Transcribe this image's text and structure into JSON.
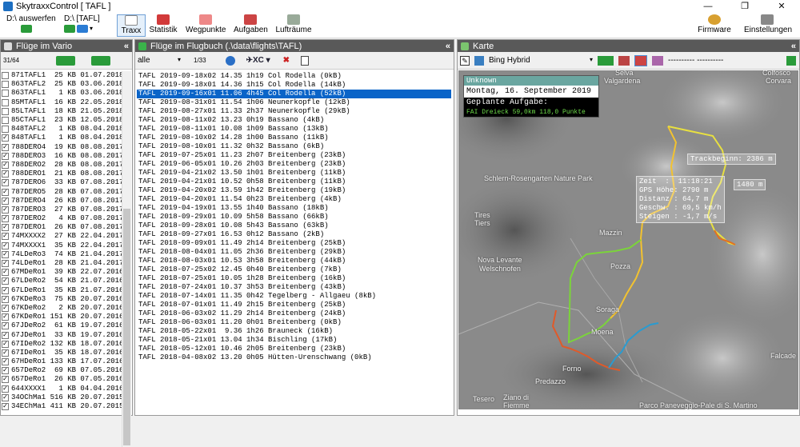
{
  "window": {
    "title": "SkytraxxControl [ TAFL ]",
    "min": "—",
    "max": "❐",
    "close": "✕"
  },
  "toolbar": {
    "drive1": "D:\\ auswerfen",
    "drive2": "D:\\ [TAFL]",
    "traxx": "Traxx",
    "statistik": "Statistik",
    "wegpunkte": "Wegpunkte",
    "aufgaben": "Aufgaben",
    "luftraeume": "Lufträume",
    "firmware": "Firmware",
    "einstellungen": "Einstellungen"
  },
  "vario": {
    "header": "Flüge im Vario",
    "count": "31/64",
    "rows": [
      {
        "c": false,
        "t": "871TAFL1  25 KB 01.07.2018"
      },
      {
        "c": false,
        "t": "863TAFL2  25 KB 03.06.2018"
      },
      {
        "c": false,
        "t": "863TAFL1   1 KB 03.06.2018"
      },
      {
        "c": false,
        "t": "85MTAFL1  16 KB 22.05.2018"
      },
      {
        "c": false,
        "t": "85LTAFL1  18 KB 21.05.2018"
      },
      {
        "c": false,
        "t": "85CTAFL1  23 KB 12.05.2018"
      },
      {
        "c": false,
        "t": "848TAFL2   1 KB 08.04.2018"
      },
      {
        "c": true,
        "t": "848TAFL1   1 KB 08.04.2018"
      },
      {
        "c": true,
        "t": "788DERO4  19 KB 08.08.2017"
      },
      {
        "c": true,
        "t": "788DERO3  16 KB 08.08.2017"
      },
      {
        "c": true,
        "t": "788DERO2  28 KB 08.08.2017"
      },
      {
        "c": true,
        "t": "788DERO1  21 KB 08.08.2017"
      },
      {
        "c": true,
        "t": "787DERO6  33 KB 07.08.2017"
      },
      {
        "c": true,
        "t": "787DERO5  28 KB 07.08.2017"
      },
      {
        "c": true,
        "t": "787DERO4  26 KB 07.08.2017"
      },
      {
        "c": true,
        "t": "787DERO3  27 KB 07.08.2017"
      },
      {
        "c": true,
        "t": "787DERO2   4 KB 07.08.2017"
      },
      {
        "c": true,
        "t": "787DERO1  26 KB 07.08.2017"
      },
      {
        "c": true,
        "t": "74MXXXX2  27 KB 22.04.2017"
      },
      {
        "c": true,
        "t": "74MXXXX1  35 KB 22.04.2017"
      },
      {
        "c": true,
        "t": "74LDeRo3  74 KB 21.04.2017"
      },
      {
        "c": true,
        "t": "74LDeRo1  28 KB 21.04.2017"
      },
      {
        "c": true,
        "t": "67MDeRo1  39 KB 22.07.2016"
      },
      {
        "c": true,
        "t": "67LDeRo2  54 KB 21.07.2016"
      },
      {
        "c": true,
        "t": "67LDeRo1  35 KB 21.07.2016"
      },
      {
        "c": true,
        "t": "67KDeRo3  75 KB 20.07.2016"
      },
      {
        "c": true,
        "t": "67KDeRo2   2 KB 20.07.2016"
      },
      {
        "c": true,
        "t": "67KDeRo1 151 KB 20.07.2016"
      },
      {
        "c": true,
        "t": "67JDeRo2  61 KB 19.07.2016"
      },
      {
        "c": true,
        "t": "67JDeRo1  33 KB 19.07.2016"
      },
      {
        "c": true,
        "t": "67IDeRo2 132 KB 18.07.2016"
      },
      {
        "c": true,
        "t": "67IDeRo1  35 KB 18.07.2016"
      },
      {
        "c": true,
        "t": "67HDeRo1 133 KB 17.07.2016"
      },
      {
        "c": true,
        "t": "657DeRo2  69 KB 07.05.2016"
      },
      {
        "c": true,
        "t": "657DeRo1  26 KB 07.05.2016"
      },
      {
        "c": true,
        "t": "644XXXX1   1 KB 04.04.2016"
      },
      {
        "c": true,
        "t": "34OChMa1 516 KB 20.07.2015"
      },
      {
        "c": true,
        "t": "34EChMa1 411 KB 20.07.2015"
      }
    ]
  },
  "flugbuch": {
    "header": "Flüge im Flugbuch (.\\data\\flights\\TAFL)",
    "filter": "alle",
    "count": "1/33",
    "rows": [
      "TAFL 2019-09-18x02 14.35 1h19 Col Rodella (0kB)",
      "TAFL 2019-09-18x01 14.36 1h15 Col Rodella (14kB)",
      "TAFL 2019-09-16x01 11.06 4h45 Col Rodella (52kB)",
      "TAFL 2019-08-31x01 11.54 1h06 Neunerkopfle (12kB)",
      "TAFL 2019-08-27x01 11.33 2h37 Neunerkopfle (29kB)",
      "TAFL 2019-08-11x02 13.23 0h19 Bassano (4kB)",
      "TAFL 2019-08-11x01 10.08 1h09 Bassano (13kB)",
      "TAFL 2019-08-10x02 14.28 1h00 Bassano (11kB)",
      "TAFL 2019-08-10x01 11.32 0h32 Bassano (6kB)",
      "TAFL 2019-07-25x01 11.23 2h07 Breitenberg (23kB)",
      "TAFL 2019-06-05x01 10.26 2h03 Breitenberg (23kB)",
      "TAFL 2019-04-21x02 13.50 1h01 Breitenberg (11kB)",
      "TAFL 2019-04-21x01 10.52 0h58 Breitenberg (11kB)",
      "TAFL 2019-04-20x02 13.59 1h42 Breitenberg (19kB)",
      "TAFL 2019-04-20x01 11.54 0h23 Breitenberg (4kB)",
      "TAFL 2019-04-19x01 13.55 1h40 Bassano (18kB)",
      "TAFL 2018-09-29x01 10.09 5h58 Bassano (66kB)",
      "TAFL 2018-09-28x01 10.08 5h43 Bassano (63kB)",
      "TAFL 2018-09-27x01 16.53 0h12 Bassano (2kB)",
      "TAFL 2018-09-09x01 11.49 2h14 Breitenberg (25kB)",
      "TAFL 2018-08-04x01 11.05 2h36 Breitenberg (29kB)",
      "TAFL 2018-08-03x01 10.53 3h58 Breitenberg (44kB)",
      "TAFL 2018-07-25x02 12.45 0h40 Breitenberg (7kB)",
      "TAFL 2018-07-25x01 10.05 1h28 Breitenberg (16kB)",
      "TAFL 2018-07-24x01 10.37 3h53 Breitenberg (43kB)",
      "TAFL 2018-07-14x01 11.35 0h42 Tegelberg - Allgaeu (8kB)",
      "TAFL 2018-07-01x01 11.49 2h15 Breitenberg (25kB)",
      "TAFL 2018-06-03x02 11.29 2h14 Breitenberg (24kB)",
      "TAFL 2018-06-03x01 11.20 0h01 Breitenberg (0kB)",
      "TAFL 2018-05-22x01  9.36 1h26 Brauneck (16kB)",
      "TAFL 2018-05-21x01 13.04 1h34 Bischling (17kB)",
      "TAFL 2018-05-12x01 10.46 2h05 Breitenberg (23kB)",
      "TAFL 2018-04-08x02 13.20 0h05 Hütten-Urenschwang (0kB)"
    ],
    "selected": 2
  },
  "karte": {
    "header": "Karte",
    "layer": "Bing Hybrid",
    "fields": "---------- ----------",
    "info": {
      "name": "Unknown",
      "date": "Montag, 16. September 2019",
      "task_title": "Geplante Aufgabe:",
      "task": "FAI Dreieck  59,0km 118,0 Punkte"
    },
    "tips": {
      "trackbeginn": "Trackbeginn: 2386 m",
      "alt": "1480 m",
      "stats": "Zeit  :  11:18:21\nGPS Höhe: 2790 m\nDistanz : 64,7 m\nGeschw. : 69,5 km/h\nSteigen : -1,7 m/s"
    },
    "labels": [
      {
        "t": "Selva"
      },
      {
        "t": "Valgardena"
      },
      {
        "t": "Colfosco"
      },
      {
        "t": "Corvara"
      },
      {
        "t": "Schlern-Rosengarten Nature Park"
      },
      {
        "t": "Tires"
      },
      {
        "t": "Tiers"
      },
      {
        "t": "Mazzin"
      },
      {
        "t": "Pozza"
      },
      {
        "t": "Nova Levante"
      },
      {
        "t": "Welschnofen"
      },
      {
        "t": "Soraga"
      },
      {
        "t": "Moena"
      },
      {
        "t": "Forno"
      },
      {
        "t": "Predazzo"
      },
      {
        "t": "Falcade"
      },
      {
        "t": "Tesero"
      },
      {
        "t": "Ziano di"
      },
      {
        "t": "Fiemme"
      },
      {
        "t": "Parco Paneveggio-Pale di S. Martino"
      }
    ]
  }
}
